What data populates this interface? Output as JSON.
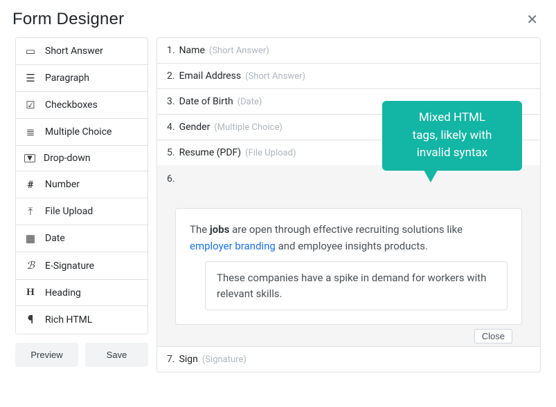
{
  "header": {
    "title": "Form Designer"
  },
  "palette": [
    {
      "icon": "short-answer-icon",
      "glyph": "▭",
      "label": "Short Answer"
    },
    {
      "icon": "paragraph-icon",
      "glyph": "☰",
      "label": "Paragraph"
    },
    {
      "icon": "checkboxes-icon",
      "glyph": "☑",
      "label": "Checkboxes"
    },
    {
      "icon": "multiple-choice-icon",
      "glyph": "≣",
      "label": "Multiple Choice"
    },
    {
      "icon": "drop-down-icon",
      "glyph": "▾",
      "label": "Drop-down"
    },
    {
      "icon": "number-icon",
      "glyph": "#",
      "label": "Number"
    },
    {
      "icon": "file-upload-icon",
      "glyph": "⤒",
      "label": "File Upload"
    },
    {
      "icon": "date-icon",
      "glyph": "▦",
      "label": "Date"
    },
    {
      "icon": "signature-icon",
      "glyph": "ℬ",
      "label": "E-Signature"
    },
    {
      "icon": "heading-icon",
      "glyph": "H",
      "label": "Heading"
    },
    {
      "icon": "rich-html-icon",
      "glyph": "¶",
      "label": "Rich HTML"
    }
  ],
  "actions": {
    "preview": "Preview",
    "save": "Save"
  },
  "fields": [
    {
      "index": "1.",
      "label": "Name",
      "type": "(Short Answer)"
    },
    {
      "index": "2.",
      "label": "Email Address",
      "type": "(Short Answer)"
    },
    {
      "index": "3.",
      "label": "Date of Birth",
      "type": "(Date)"
    },
    {
      "index": "4.",
      "label": "Gender",
      "type": "(Multiple Choice)"
    },
    {
      "index": "5.",
      "label": "Resume (PDF)",
      "type": "(File Upload)"
    }
  ],
  "editor": {
    "index": "6.",
    "rich_pre": "The ",
    "rich_bold": "jobs",
    "rich_mid": " are open through effective recruiting solutions like ",
    "rich_link": "employer branding",
    "rich_post": " and employee insights products.",
    "nested": "These companies have a spike in demand for workers with relevant skills.",
    "close": "Close"
  },
  "callout": {
    "line1": "Mixed HTML",
    "line2": "tags, likely with",
    "line3": "invalid syntax"
  },
  "trailing": {
    "index": "7.",
    "label": "Sign",
    "type": "(Signature)"
  }
}
